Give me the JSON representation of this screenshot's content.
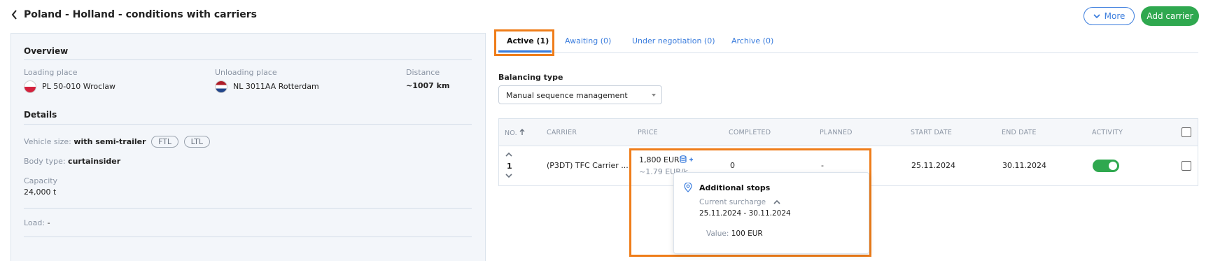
{
  "header": {
    "title": "Poland - Holland - conditions with carriers",
    "more_label": "More",
    "add_carrier_label": "Add carrier"
  },
  "overview": {
    "title": "Overview",
    "loading_label": "Loading place",
    "loading_value": "PL 50-010 Wroclaw",
    "unloading_label": "Unloading place",
    "unloading_value": "NL 3011AA Rotterdam",
    "distance_label": "Distance",
    "distance_value": "~1007 km"
  },
  "details": {
    "title": "Details",
    "vehicle_size_label": "Vehicle size:",
    "vehicle_size_value": "with semi-trailer",
    "pill_ftl": "FTL",
    "pill_ltl": "LTL",
    "body_type_label": "Body type:",
    "body_type_value": "curtainsider",
    "capacity_label": "Capacity",
    "capacity_value": "24,000 t",
    "load_label": "Load:",
    "load_value": "-"
  },
  "tabs": [
    {
      "label": "Active (1)",
      "active": true
    },
    {
      "label": "Awaiting (0)",
      "active": false
    },
    {
      "label": "Under negotiation (0)",
      "active": false
    },
    {
      "label": "Archive (0)",
      "active": false
    }
  ],
  "balancing": {
    "label": "Balancing type",
    "selected": "Manual sequence management"
  },
  "table": {
    "columns": [
      "NO.",
      "CARRIER",
      "PRICE",
      "COMPLETED",
      "PLANNED",
      "START DATE",
      "END DATE",
      "ACTIVITY"
    ],
    "rows": [
      {
        "no": "1",
        "carrier": "(P3DT) TFC Carrier ...",
        "price": "1,800 EUR",
        "price_per_km": "~1.79 EUR/k",
        "completed": "0",
        "planned": "-",
        "start_date": "25.11.2024",
        "end_date": "30.11.2024",
        "activity_on": true
      }
    ]
  },
  "popover": {
    "title": "Additional stops",
    "subtitle": "Current surcharge",
    "dates": "25.11.2024 - 30.11.2024",
    "value_label": "Value:",
    "value": "100 EUR"
  },
  "colors": {
    "accent": "#3b7ddd",
    "success": "#2fa84f",
    "highlight": "#ef7d1a"
  }
}
